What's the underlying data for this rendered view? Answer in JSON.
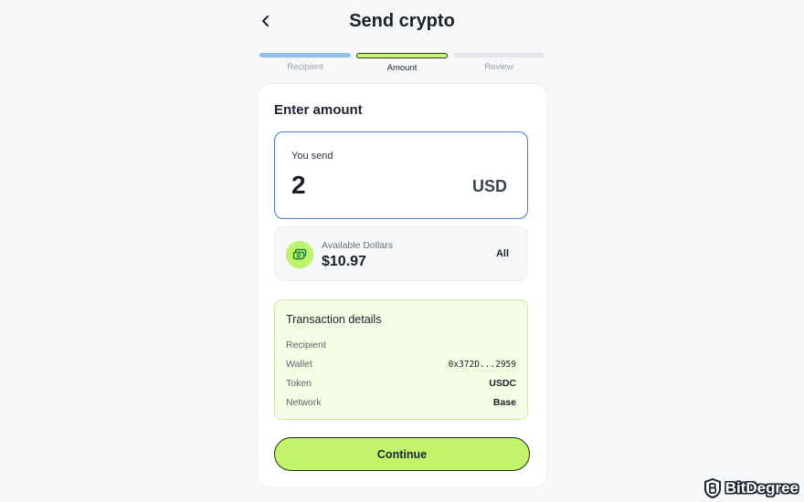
{
  "header": {
    "title": "Send crypto"
  },
  "stepper": {
    "steps": [
      {
        "label": "Recipient",
        "state": "done"
      },
      {
        "label": "Amount",
        "state": "active"
      },
      {
        "label": "Review",
        "state": "pending"
      }
    ]
  },
  "amount_section": {
    "title": "Enter amount",
    "you_send_label": "You send",
    "amount_value": "2",
    "currency": "USD"
  },
  "available": {
    "label": "Available Dollars",
    "value": "$10.97",
    "all_label": "All",
    "icon": "cash-icon"
  },
  "transaction": {
    "title": "Transaction details",
    "rows": [
      {
        "key": "Recipient",
        "value": ""
      },
      {
        "key": "Wallet",
        "value": "0x372D...2959"
      },
      {
        "key": "Token",
        "value": "USDC"
      },
      {
        "key": "Network",
        "value": "Base"
      }
    ]
  },
  "continue_label": "Continue",
  "watermark": {
    "text": "BitDegree"
  },
  "colors": {
    "accent": "#c2f56c",
    "input_border": "#4a78d8",
    "step_done": "#8fbef0",
    "tx_background": "#f4fde4"
  }
}
